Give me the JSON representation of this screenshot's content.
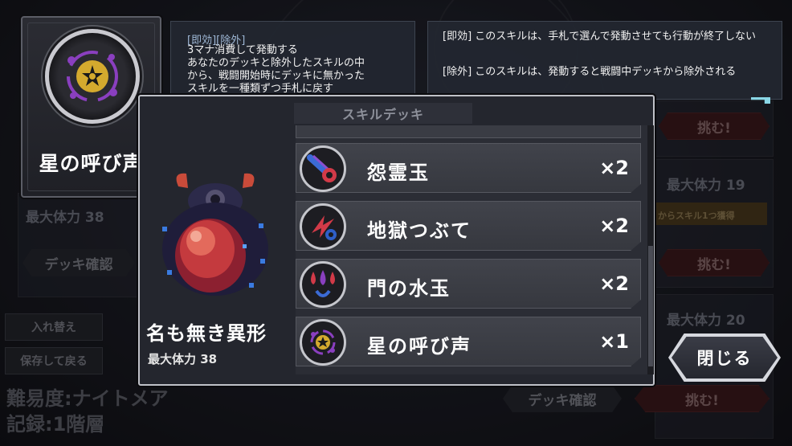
{
  "skill_card": {
    "title": "星の呼び声"
  },
  "tooltip": {
    "tags": "[即効][除外]",
    "description": "3マナ消費して発動する\nあなたのデッキと除外したスキルの中\nから、戦闘開始時にデッキに無かった\nスキルを一種類ずつ手札に戻す"
  },
  "glossary": {
    "immediate": "[即効] このスキルは、手札で選んで発動させても行動が終了しない",
    "exclude": "[除外] このスキルは、発動すると戦闘中デッキから除外される"
  },
  "deck_modal": {
    "header": "スキルデッキ",
    "monster_name": "名も無き異形",
    "monster_hp": "最大体力 38",
    "skills": [
      {
        "name": "怨霊玉",
        "count": "×2",
        "icon": "spirit-orb-icon"
      },
      {
        "name": "地獄つぶて",
        "count": "×2",
        "icon": "hell-pebble-icon"
      },
      {
        "name": "門の水玉",
        "count": "×2",
        "icon": "gate-water-icon"
      },
      {
        "name": "星の呼び声",
        "count": "×1",
        "icon": "star-call-icon"
      }
    ]
  },
  "close_button": {
    "label": "閉じる"
  },
  "background": {
    "left_hp": "最大体力 38",
    "deck_confirm_left": "デッキ確認",
    "swap_button": "入れ替え",
    "save_return_button": "保存して戻る",
    "difficulty": "難易度:ナイトメア",
    "record": "記録:1階層",
    "right_hp_1": "最大体力 19",
    "right_hp_2": "最大体力 20",
    "challenge_1": "挑む!",
    "challenge_2": "挑む!",
    "challenge_3": "挑む!",
    "deck_confirm_bottom": "デッキ確認",
    "right_hint": "からスキル1つ獲得"
  }
}
